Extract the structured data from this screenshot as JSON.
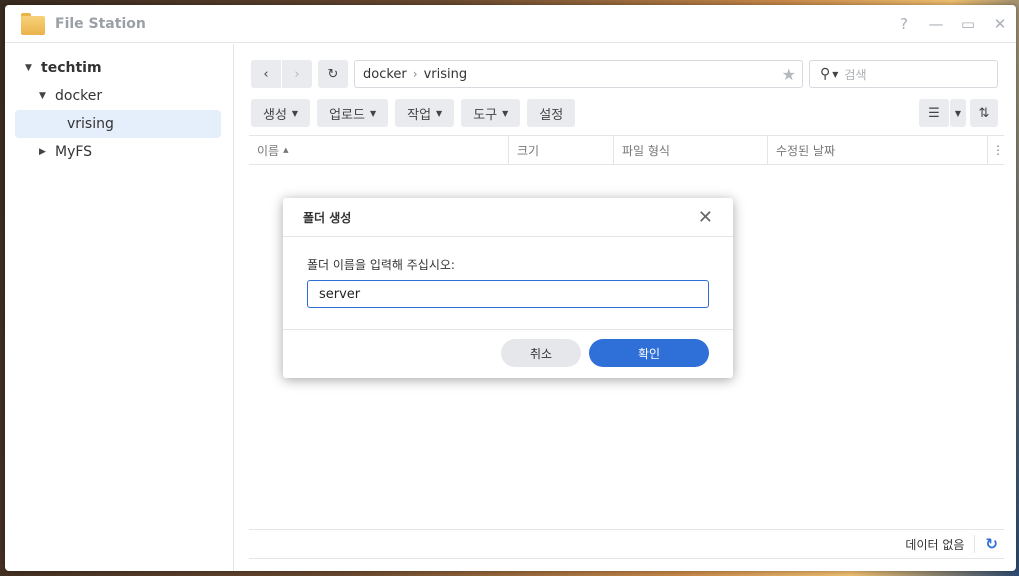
{
  "window": {
    "title": "File Station",
    "icon": "folder-icon"
  },
  "window_controls": {
    "help": "?",
    "minimize": "—",
    "maximize": "▭",
    "close": "✕"
  },
  "sidebar": {
    "items": [
      {
        "label": "techtim",
        "level": 0,
        "expanded": true,
        "bold": true
      },
      {
        "label": "docker",
        "level": 1,
        "expanded": true
      },
      {
        "label": "vrising",
        "level": 2,
        "selected": true
      },
      {
        "label": "MyFS",
        "level": 0,
        "expanded": false
      }
    ]
  },
  "path": {
    "segments": [
      "docker",
      "vrising"
    ],
    "separator": "›"
  },
  "search": {
    "placeholder": "검색"
  },
  "toolbar": {
    "create": "생성",
    "upload": "업로드",
    "action": "작업",
    "tools": "도구",
    "settings": "설정"
  },
  "columns": {
    "name": "이름",
    "size": "크기",
    "type": "파일 형식",
    "modified": "수정된 날짜"
  },
  "status": {
    "text": "데이터 없음"
  },
  "dialog": {
    "title": "폴더 생성",
    "label": "폴더 이름을 입력해 주십시오:",
    "input_value": "server",
    "cancel": "취소",
    "ok": "확인"
  },
  "colors": {
    "accent": "#2f6fd8",
    "selected_bg": "#e5eefb",
    "button_bg": "#e9ebee"
  }
}
